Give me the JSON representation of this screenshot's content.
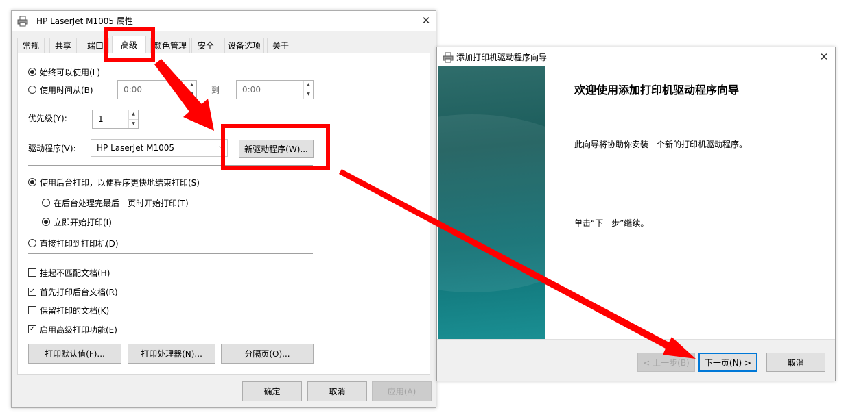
{
  "colors": {
    "annotation_red": "#ff0000",
    "focus_blue": "#0078d7",
    "wizard_teal": "#1a6e70"
  },
  "printer_properties": {
    "title": "HP LaserJet M1005 属性",
    "close_icon": "close-icon",
    "tabs": [
      "常规",
      "共享",
      "端口",
      "高级",
      "颜色管理",
      "安全",
      "设备选项",
      "关于"
    ],
    "active_tab": "高级",
    "advanced": {
      "always_available_label": "始终可以使用(L)",
      "available_from_label": "使用时间从(B)",
      "from_time": "0:00",
      "to_label": "到",
      "to_time": "0:00",
      "priority_label": "优先级(Y):",
      "priority_value": "1",
      "driver_label": "驱动程序(V):",
      "driver_value": "HP LaserJet M1005",
      "new_driver_button": "新驱动程序(W)...",
      "spool_label": "使用后台打印，以便程序更快地结束打印(S)",
      "start_after_last_page_label": "在后台处理完最后一页时开始打印(T)",
      "start_immediately_label": "立即开始打印(I)",
      "print_direct_label": "直接打印到打印机(D)",
      "hold_mismatched_label": "挂起不匹配文档(H)",
      "hold_mismatched_checked": false,
      "spooled_first_label": "首先打印后台文档(R)",
      "spooled_first_checked": true,
      "keep_printed_label": "保留打印的文档(K)",
      "keep_printed_checked": false,
      "enable_advanced_label": "启用高级打印功能(E)",
      "enable_advanced_checked": true,
      "printing_defaults_button": "打印默认值(F)...",
      "print_processor_button": "打印处理器(N)...",
      "separator_page_button": "分隔页(O)..."
    },
    "ok_button": "确定",
    "cancel_button": "取消",
    "apply_button": "应用(A)"
  },
  "driver_wizard": {
    "title": "添加打印机驱动程序向导",
    "heading": "欢迎使用添加打印机驱动程序向导",
    "description": "此向导将协助你安装一个新的打印机驱动程序。",
    "continue_text": "单击“下一步”继续。",
    "back_button": "< 上一步(B)",
    "next_button": "下一页(N) >",
    "cancel_button": "取消"
  }
}
